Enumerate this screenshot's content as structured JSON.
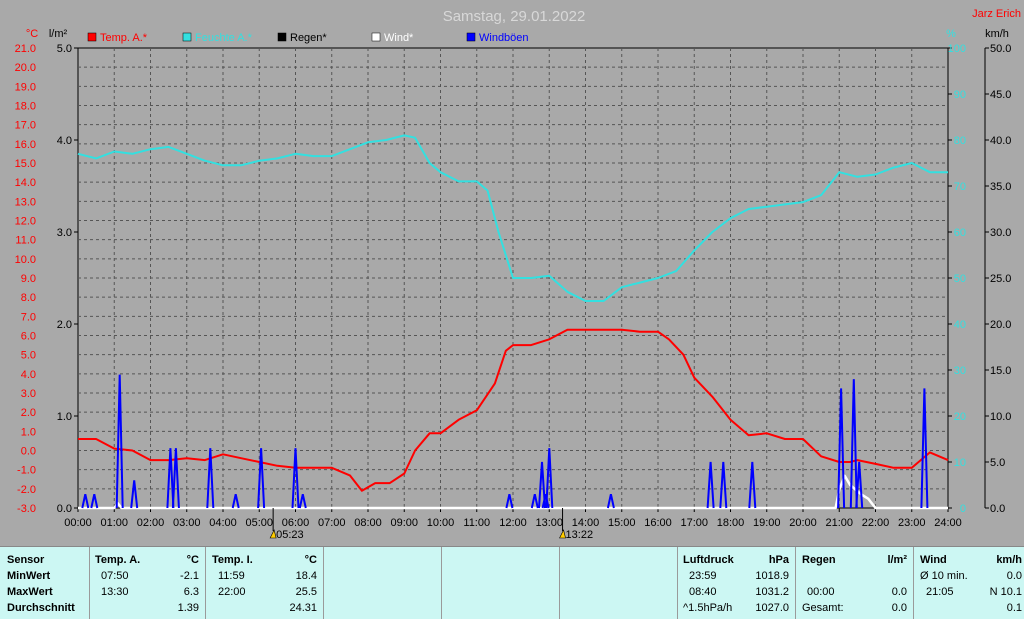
{
  "header": {
    "title": "Samstag, 29.01.2022",
    "author": "Jarz Erich",
    "unit_temp": "°C",
    "unit_rain": "l/m²",
    "unit_percent": "%",
    "unit_wind": "km/h"
  },
  "legend": [
    {
      "label": "Temp. A.*",
      "color": "#ff0000"
    },
    {
      "label": "Feuchte A.*",
      "color": "#33e0e0"
    },
    {
      "label": "Regen*",
      "color": "#000000"
    },
    {
      "label": "Wind*",
      "color": "#ffffff"
    },
    {
      "label": "Windböen",
      "color": "#0000ff"
    }
  ],
  "markers": [
    {
      "label": "05:23",
      "time": 5.383
    },
    {
      "label": "13:22",
      "time": 13.367
    }
  ],
  "chart_data": {
    "type": "line",
    "title": "Samstag, 29.01.2022",
    "x_ticks": [
      "00:00",
      "01:00",
      "02:00",
      "03:00",
      "04:00",
      "05:00",
      "06:00",
      "07:00",
      "08:00",
      "09:00",
      "10:00",
      "11:00",
      "12:00",
      "13:00",
      "14:00",
      "15:00",
      "16:00",
      "17:00",
      "18:00",
      "19:00",
      "20:00",
      "21:00",
      "22:00",
      "23:00",
      "24:00"
    ],
    "xlim": [
      0,
      24
    ],
    "axes": {
      "temp": {
        "unit": "°C",
        "range": [
          -3,
          21
        ],
        "ticks": [
          "-3.0",
          "-2.0",
          "-1.0",
          "0.0",
          "1.0",
          "2.0",
          "3.0",
          "4.0",
          "5.0",
          "6.0",
          "7.0",
          "8.0",
          "9.0",
          "10.0",
          "11.0",
          "12.0",
          "13.0",
          "14.0",
          "15.0",
          "16.0",
          "17.0",
          "18.0",
          "19.0",
          "20.0",
          "21.0"
        ],
        "color": "#ff0000"
      },
      "rain": {
        "unit": "l/m²",
        "range": [
          0,
          5
        ],
        "ticks": [
          "0.0",
          "1.0",
          "2.0",
          "3.0",
          "4.0",
          "5.0"
        ],
        "color": "#000000"
      },
      "humidity": {
        "unit": "%",
        "range": [
          0,
          100
        ],
        "ticks": [
          "0",
          "10",
          "20",
          "30",
          "40",
          "50",
          "60",
          "70",
          "80",
          "90",
          "100"
        ],
        "color": "#33e0e0"
      },
      "wind": {
        "unit": "km/h",
        "range": [
          0,
          50
        ],
        "ticks": [
          "0.0",
          "5.0",
          "10.0",
          "15.0",
          "20.0",
          "25.0",
          "30.0",
          "35.0",
          "40.0",
          "45.0",
          "50.0"
        ],
        "color": "#000000"
      }
    },
    "series": [
      {
        "name": "Temp. A.*",
        "axis": "temp",
        "color": "#ff0000",
        "points": [
          [
            0,
            0.6
          ],
          [
            0.5,
            0.6
          ],
          [
            1,
            0.1
          ],
          [
            1.5,
            0
          ],
          [
            2,
            -0.5
          ],
          [
            2.5,
            -0.5
          ],
          [
            3,
            -0.4
          ],
          [
            3.5,
            -0.5
          ],
          [
            4,
            -0.2
          ],
          [
            4.5,
            -0.4
          ],
          [
            5,
            -0.6
          ],
          [
            5.5,
            -0.8
          ],
          [
            6,
            -0.9
          ],
          [
            6.5,
            -0.9
          ],
          [
            7,
            -0.9
          ],
          [
            7.5,
            -1.3
          ],
          [
            7.833,
            -2.1
          ],
          [
            8.2,
            -1.7
          ],
          [
            8.6,
            -1.7
          ],
          [
            9,
            -1.2
          ],
          [
            9.3,
            0
          ],
          [
            9.7,
            0.9
          ],
          [
            10,
            0.9
          ],
          [
            10.5,
            1.6
          ],
          [
            11,
            2.1
          ],
          [
            11.5,
            3.5
          ],
          [
            11.8,
            5.2
          ],
          [
            12,
            5.5
          ],
          [
            12.5,
            5.5
          ],
          [
            13,
            5.8
          ],
          [
            13.5,
            6.3
          ],
          [
            14,
            6.3
          ],
          [
            14.5,
            6.3
          ],
          [
            15,
            6.3
          ],
          [
            15.5,
            6.2
          ],
          [
            16,
            6.2
          ],
          [
            16.3,
            5.8
          ],
          [
            16.7,
            5
          ],
          [
            17,
            3.8
          ],
          [
            17.5,
            2.8
          ],
          [
            18,
            1.6
          ],
          [
            18.5,
            0.8
          ],
          [
            19,
            0.9
          ],
          [
            19.5,
            0.6
          ],
          [
            20,
            0.6
          ],
          [
            20.5,
            -0.3
          ],
          [
            21,
            -0.6
          ],
          [
            21.3,
            -0.6
          ],
          [
            21.5,
            -0.5
          ],
          [
            22,
            -0.7
          ],
          [
            22.5,
            -0.9
          ],
          [
            23,
            -0.9
          ],
          [
            23.5,
            -0.1
          ],
          [
            24,
            -0.5
          ]
        ]
      },
      {
        "name": "Feuchte A.*",
        "axis": "humidity",
        "color": "#33e0e0",
        "points": [
          [
            0,
            77
          ],
          [
            0.5,
            76
          ],
          [
            1,
            77.5
          ],
          [
            1.5,
            77
          ],
          [
            2,
            78
          ],
          [
            2.5,
            78.5
          ],
          [
            3,
            77
          ],
          [
            3.5,
            75.5
          ],
          [
            4,
            74.5
          ],
          [
            4.5,
            74.5
          ],
          [
            5,
            75.5
          ],
          [
            5.5,
            76
          ],
          [
            6,
            77
          ],
          [
            6.5,
            76.5
          ],
          [
            7,
            76.5
          ],
          [
            7.5,
            78
          ],
          [
            8,
            79.5
          ],
          [
            8.5,
            80
          ],
          [
            9,
            81
          ],
          [
            9.3,
            80.5
          ],
          [
            9.7,
            75
          ],
          [
            10,
            73
          ],
          [
            10.5,
            71
          ],
          [
            11,
            71
          ],
          [
            11.3,
            69
          ],
          [
            11.6,
            60
          ],
          [
            12,
            50
          ],
          [
            12.5,
            50
          ],
          [
            13,
            50.5
          ],
          [
            13.5,
            47
          ],
          [
            14,
            45
          ],
          [
            14.5,
            45
          ],
          [
            15,
            48
          ],
          [
            15.5,
            49
          ],
          [
            16,
            50
          ],
          [
            16.5,
            51.5
          ],
          [
            17,
            56
          ],
          [
            17.5,
            60
          ],
          [
            18,
            63
          ],
          [
            18.5,
            65
          ],
          [
            19,
            65.5
          ],
          [
            19.5,
            66
          ],
          [
            20,
            66.5
          ],
          [
            20.5,
            68
          ],
          [
            21,
            73
          ],
          [
            21.5,
            72
          ],
          [
            22,
            72.5
          ],
          [
            22.5,
            74
          ],
          [
            23,
            75
          ],
          [
            23.5,
            73
          ],
          [
            24,
            73
          ]
        ]
      },
      {
        "name": "Regen*",
        "axis": "rain",
        "color": "#000000",
        "points": [
          [
            0,
            0
          ],
          [
            24,
            0
          ]
        ]
      },
      {
        "name": "Wind*",
        "axis": "wind",
        "color": "#ffffff",
        "points": [
          [
            0,
            0
          ],
          [
            1.0,
            0
          ],
          [
            1.1,
            0.5
          ],
          [
            1.2,
            0
          ],
          [
            20.9,
            0
          ],
          [
            21.0,
            2.0
          ],
          [
            21.15,
            3.5
          ],
          [
            21.3,
            2.5
          ],
          [
            21.6,
            1.5
          ],
          [
            21.8,
            1.0
          ],
          [
            22.0,
            0
          ],
          [
            24,
            0
          ]
        ]
      },
      {
        "name": "Windböen",
        "axis": "wind",
        "color": "#0000ff",
        "spikes": [
          [
            0.2,
            1.5
          ],
          [
            0.45,
            1.5
          ],
          [
            1.15,
            14.5
          ],
          [
            1.55,
            3
          ],
          [
            2.55,
            6.5
          ],
          [
            2.7,
            6.5
          ],
          [
            3.65,
            6.5
          ],
          [
            4.35,
            1.5
          ],
          [
            5.05,
            6.5
          ],
          [
            6.0,
            6.5
          ],
          [
            6.2,
            1.5
          ],
          [
            11.9,
            1.5
          ],
          [
            12.6,
            1.5
          ],
          [
            12.8,
            5
          ],
          [
            12.9,
            1.5
          ],
          [
            13.0,
            6.5
          ],
          [
            14.7,
            1.5
          ],
          [
            17.45,
            5
          ],
          [
            17.8,
            5
          ],
          [
            18.6,
            5
          ],
          [
            21.05,
            13
          ],
          [
            21.4,
            14
          ],
          [
            21.55,
            5
          ],
          [
            23.35,
            13
          ]
        ]
      }
    ]
  },
  "table": {
    "sensor": {
      "header": "Sensor",
      "rows": [
        "MinWert",
        "MaxWert",
        "Durchschnitt"
      ]
    },
    "temp_a": {
      "header": "Temp. A.",
      "unit": "°C",
      "times": [
        "07:50",
        "13:30",
        ""
      ],
      "values": [
        "-2.1",
        "6.3",
        "1.39"
      ]
    },
    "temp_i": {
      "header": "Temp. I.",
      "unit": "°C",
      "times": [
        "11:59",
        "22:00",
        ""
      ],
      "values": [
        "18.4",
        "25.5",
        "24.31"
      ]
    },
    "pressure": {
      "header": "Luftdruck",
      "unit": "hPa",
      "times": [
        "23:59",
        "08:40",
        "^1.5hPa/h"
      ],
      "values": [
        "1018.9",
        "1031.2",
        "1027.0"
      ]
    },
    "rain": {
      "header": "Regen",
      "unit": "l/m²",
      "times": [
        "",
        "00:00",
        "Gesamt:"
      ],
      "values": [
        "",
        "0.0",
        "0.0"
      ]
    },
    "wind": {
      "header": "Wind",
      "unit": "km/h",
      "times": [
        "Ø 10 min.",
        "21:05",
        ""
      ],
      "values": [
        "0.0",
        "N 10.1",
        "0.1"
      ]
    }
  }
}
